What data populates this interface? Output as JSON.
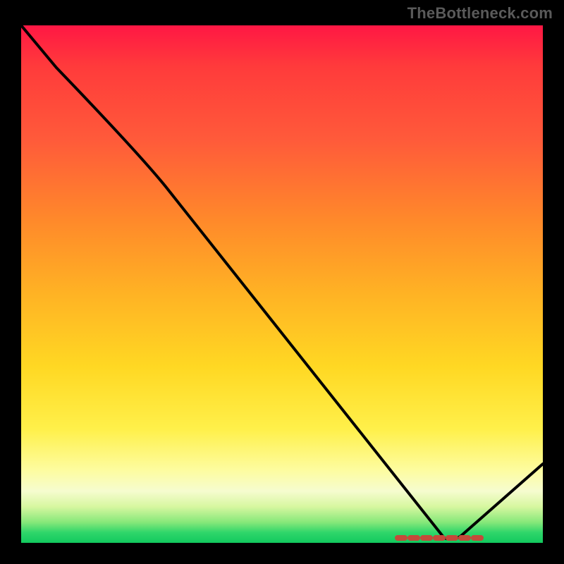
{
  "watermark": "TheBottleneck.com",
  "colors": {
    "line": "#000000",
    "marker": "#c34a3a",
    "frame": "#000000"
  },
  "chart_data": {
    "type": "line",
    "title": "",
    "xlabel": "",
    "ylabel": "",
    "xlim": [
      0,
      100
    ],
    "ylim": [
      0,
      100
    ],
    "grid": false,
    "legend": false,
    "series": [
      {
        "name": "black-curve",
        "x": [
          0,
          25,
          82,
          100
        ],
        "y": [
          100,
          76,
          0,
          14
        ]
      }
    ],
    "annotations": [
      {
        "name": "red-dashed-marker",
        "y": 0.8,
        "x_start": 72,
        "x_end": 89
      }
    ],
    "background_gradient_stops": [
      {
        "pct": 0,
        "color": "#ff1744"
      },
      {
        "pct": 22,
        "color": "#ff5a3a"
      },
      {
        "pct": 52,
        "color": "#ffb324"
      },
      {
        "pct": 78,
        "color": "#fff04a"
      },
      {
        "pct": 90,
        "color": "#f6fccf"
      },
      {
        "pct": 100,
        "color": "#12c95e"
      }
    ]
  }
}
